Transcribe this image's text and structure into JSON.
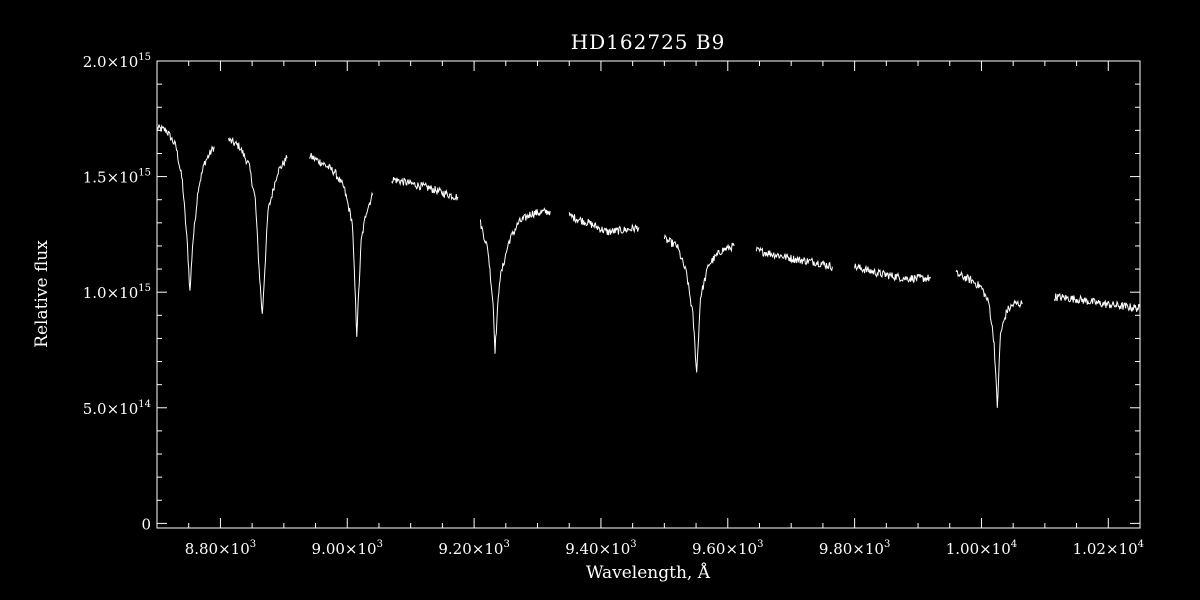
{
  "chart_data": {
    "type": "line",
    "title": "HD162725   B9",
    "xlabel": "Wavelength, Å",
    "ylabel": "Relative flux",
    "xlim": [
      8700,
      10250
    ],
    "ylim": [
      -20000000000000,
      2000000000000000
    ],
    "x_ticks": [
      {
        "value": 8800,
        "mant": "8.80×10",
        "exp": "3"
      },
      {
        "value": 9000,
        "mant": "9.00×10",
        "exp": "3"
      },
      {
        "value": 9200,
        "mant": "9.20×10",
        "exp": "3"
      },
      {
        "value": 9400,
        "mant": "9.40×10",
        "exp": "3"
      },
      {
        "value": 9600,
        "mant": "9.60×10",
        "exp": "3"
      },
      {
        "value": 9800,
        "mant": "9.80×10",
        "exp": "3"
      },
      {
        "value": 10000,
        "mant": "1.00×10",
        "exp": "4"
      },
      {
        "value": 10200,
        "mant": "1.02×10",
        "exp": "4"
      }
    ],
    "y_ticks": [
      {
        "value": 0,
        "mant": "0",
        "exp": ""
      },
      {
        "value": 500000000000000,
        "mant": "5.0×10",
        "exp": "14"
      },
      {
        "value": 1000000000000000,
        "mant": "1.0×10",
        "exp": "15"
      },
      {
        "value": 1500000000000000,
        "mant": "1.5×10",
        "exp": "15"
      },
      {
        "value": 2000000000000000,
        "mant": "2.0×10",
        "exp": "15"
      }
    ],
    "grid": false,
    "legend": "none",
    "colors": {
      "background": "#000000",
      "foreground": "#ffffff"
    },
    "series": [
      {
        "x": [
          8700,
          8715,
          8730,
          8740,
          8748,
          8752,
          8756,
          8765,
          8775,
          8790
        ],
        "y": [
          1710000000000000.0,
          1700000000000000.0,
          1630000000000000.0,
          1480000000000000.0,
          1200000000000000.0,
          1000000000000000.0,
          1200000000000000.0,
          1450000000000000.0,
          1560000000000000.0,
          1630000000000000.0
        ]
      },
      {
        "x": [
          8812,
          8830,
          8845,
          8855,
          8861,
          8866,
          8875,
          8890,
          8905
        ],
        "y": [
          1660000000000000.0,
          1630000000000000.0,
          1550000000000000.0,
          1400000000000000.0,
          1100000000000000.0,
          900000000000000.0,
          1350000000000000.0,
          1520000000000000.0,
          1580000000000000.0
        ]
      },
      {
        "x": [
          8940,
          8960,
          8980,
          8995,
          9008,
          9015,
          9022,
          9030,
          9040
        ],
        "y": [
          1590000000000000.0,
          1560000000000000.0,
          1520000000000000.0,
          1450000000000000.0,
          1300000000000000.0,
          820000000000000.0,
          1220000000000000.0,
          1350000000000000.0,
          1420000000000000.0
        ]
      },
      {
        "x": [
          9070,
          9100,
          9130,
          9150,
          9175
        ],
        "y": [
          1490000000000000.0,
          1470000000000000.0,
          1450000000000000.0,
          1430000000000000.0,
          1410000000000000.0
        ]
      },
      {
        "x": [
          9210,
          9222,
          9230,
          9233,
          9240,
          9255,
          9270,
          9290,
          9320
        ],
        "y": [
          1300000000000000.0,
          1180000000000000.0,
          950000000000000.0,
          750000000000000.0,
          1050000000000000.0,
          1220000000000000.0,
          1300000000000000.0,
          1340000000000000.0,
          1350000000000000.0
        ]
      },
      {
        "x": [
          9350,
          9380,
          9410,
          9440,
          9460
        ],
        "y": [
          1330000000000000.0,
          1300000000000000.0,
          1260000000000000.0,
          1270000000000000.0,
          1280000000000000.0
        ]
      },
      {
        "x": [
          9500,
          9520,
          9535,
          9545,
          9551,
          9557,
          9570,
          9590,
          9610
        ],
        "y": [
          1230000000000000.0,
          1200000000000000.0,
          1080000000000000.0,
          900000000000000.0,
          650000000000000.0,
          980000000000000.0,
          1120000000000000.0,
          1180000000000000.0,
          1200000000000000.0
        ]
      },
      {
        "x": [
          9645,
          9680,
          9710,
          9740,
          9765
        ],
        "y": [
          1180000000000000.0,
          1160000000000000.0,
          1140000000000000.0,
          1130000000000000.0,
          1110000000000000.0
        ]
      },
      {
        "x": [
          9800,
          9840,
          9880,
          9920
        ],
        "y": [
          1110000000000000.0,
          1080000000000000.0,
          1060000000000000.0,
          1060000000000000.0
        ]
      },
      {
        "x": [
          9960,
          9985,
          10000,
          10012,
          10020,
          10025,
          10030,
          10040,
          10052,
          10065
        ],
        "y": [
          1080000000000000.0,
          1050000000000000.0,
          1020000000000000.0,
          950000000000000.0,
          780000000000000.0,
          500000000000000.0,
          820000000000000.0,
          920000000000000.0,
          950000000000000.0,
          950000000000000.0
        ]
      },
      {
        "x": [
          10115,
          10150,
          10190,
          10220,
          10250
        ],
        "y": [
          980000000000000.0,
          970000000000000.0,
          950000000000000.0,
          940000000000000.0,
          930000000000000.0
        ]
      }
    ]
  }
}
